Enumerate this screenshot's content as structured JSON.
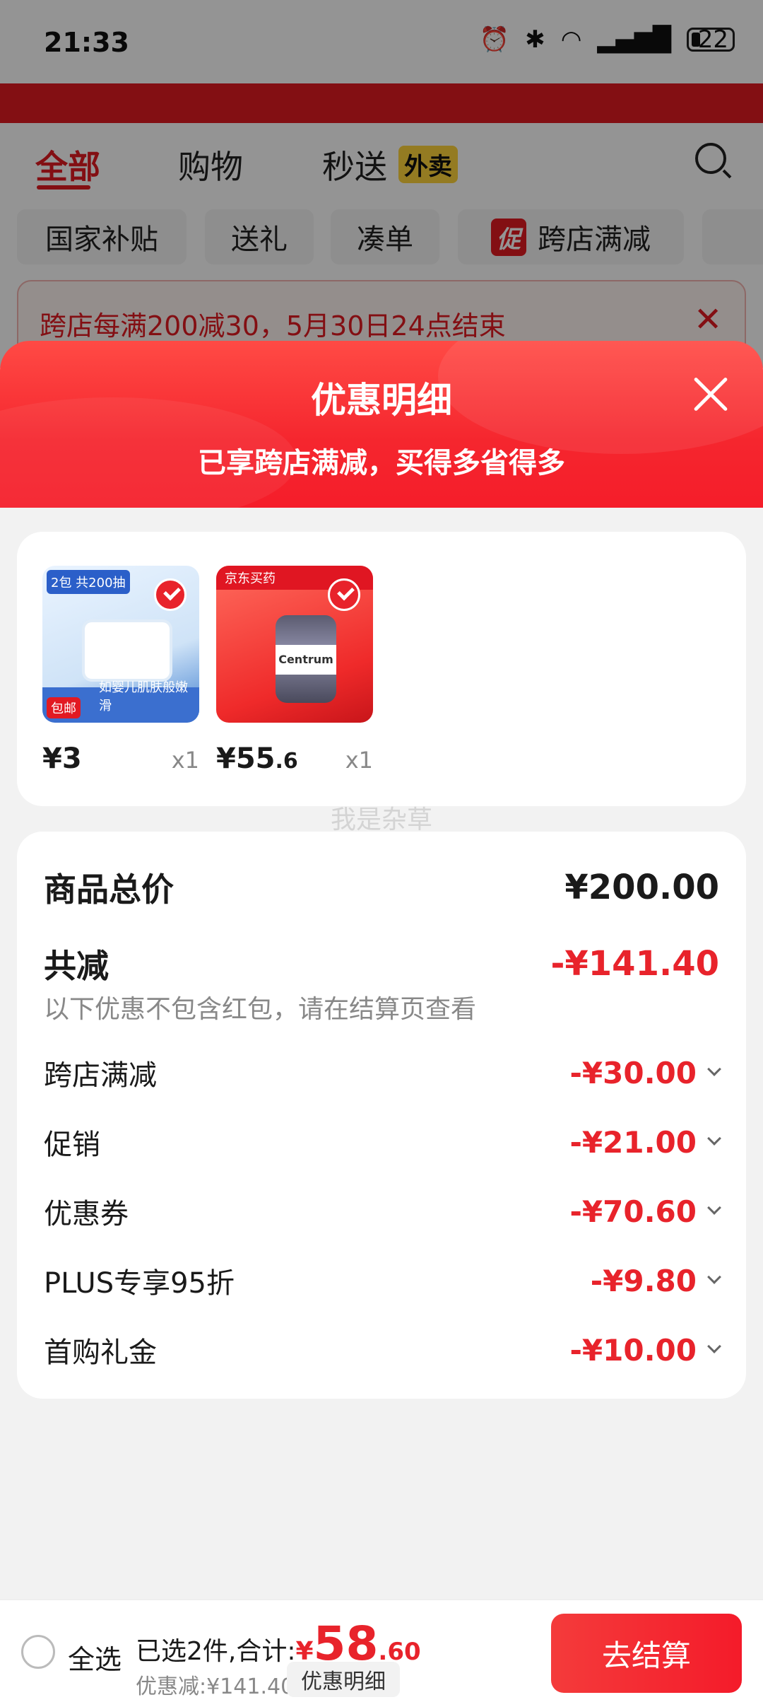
{
  "status_bar": {
    "time": "21:33",
    "icons": [
      "alarm-icon",
      "bluetooth-icon",
      "wifi-icon",
      "signal-5g-icon"
    ],
    "battery": "22"
  },
  "background": {
    "tabs": [
      {
        "label": "全部",
        "active": true
      },
      {
        "label": "购物",
        "active": false
      },
      {
        "label": "秒送",
        "active": false
      }
    ],
    "tab_badge": "外卖",
    "chips": [
      "国家补贴",
      "送礼",
      "凑单",
      "跨店满减"
    ],
    "chip_promo_badge": "促",
    "banner_text": "跨店每满200减30，5月30日24点结束",
    "banner_close": "✕"
  },
  "sheet": {
    "title": "优惠明细",
    "subtitle": "已享跨店满减，买得多省得多"
  },
  "products": [
    {
      "price_int": "¥3",
      "price_dec": "",
      "qty": "x1",
      "img_badge": "2包 共200抽",
      "img_tag": "包邮",
      "img_strip_text": "如婴儿肌肤般嫩滑"
    },
    {
      "price_int": "¥55",
      "price_dec": ".6",
      "qty": "x1",
      "img_top_text": "京东买药",
      "img_label": "Centrum"
    }
  ],
  "watermark": "我是杂草",
  "detail": {
    "total_label": "商品总价",
    "total_value": "¥200.00",
    "reduce_label": "共减",
    "reduce_value": "-¥141.40",
    "note": "以下优惠不包含红包，请在结算页查看",
    "items": [
      {
        "label": "跨店满减",
        "value": "-¥30.00"
      },
      {
        "label": "促销",
        "value": "-¥21.00"
      },
      {
        "label": "优惠券",
        "value": "-¥70.60"
      },
      {
        "label": "PLUS专享95折",
        "value": "-¥9.80"
      },
      {
        "label": "首购礼金",
        "value": "-¥10.00"
      }
    ]
  },
  "bottom_bar": {
    "select_all": "全选",
    "summary_label": "已选2件,合计:",
    "total_currency": "¥",
    "total_int": "58",
    "total_dec": ".60",
    "saved": "优惠减:¥141.40",
    "detail_button": "优惠明细",
    "checkout_button": "去结算"
  },
  "colors": {
    "accent_red": "#e8232b",
    "header_red": "#f5262e"
  }
}
